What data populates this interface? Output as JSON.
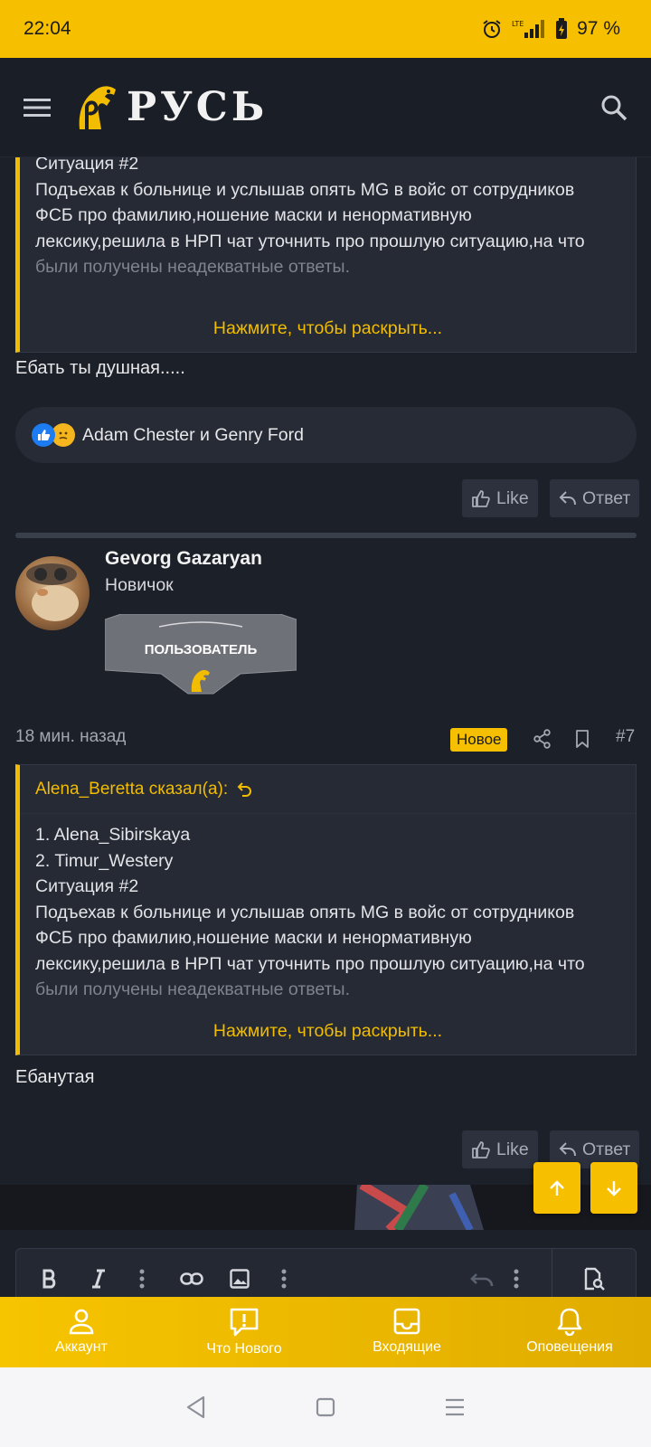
{
  "status_bar": {
    "time": "22:04",
    "battery": "97 %",
    "network": "LTE"
  },
  "app": {
    "logo_text": "РУСЬ"
  },
  "quote1": {
    "lines": [
      "Ситуация #2",
      "Подъехав к больнице и услышав опять MG в войс от сотрудников",
      "ФСБ про фамилию,ношение маски и ненормативную",
      "лексику,решила в НРП чат уточнить про прошлую ситуацию,на что"
    ],
    "fade_line": "были получены неадекватные ответы.",
    "expand_label": "Нажмите, чтобы раскрыть..."
  },
  "post1": {
    "text": "Ебать ты душная.....",
    "reactions_text": "Adam Chester и Genry Ford",
    "like_label": "Like",
    "reply_label": "Ответ"
  },
  "post2": {
    "author": "Gevorg Gazaryan",
    "user_title": "Новичок",
    "banner_text": "ПОЛЬЗОВАТЕЛЬ",
    "time": "18 мин. назад",
    "badge": "Новое",
    "number": "#7",
    "quote_author": "Alena_Beretta сказал(а):",
    "quote_lines": [
      "1. Alena_Sibirskaya",
      "2. Timur_Westery",
      "Ситуация #2",
      "Подъехав к больнице и услышав опять MG в войс от сотрудников",
      "ФСБ про фамилию,ношение маски и ненормативную",
      "лексику,решила в НРП чат уточнить про прошлую ситуацию,на что"
    ],
    "quote_fade_line": "были получены неадекватные ответы.",
    "expand_label": "Нажмите, чтобы раскрыть...",
    "text": "Ебанутая",
    "like_label": "Like",
    "reply_label": "Ответ"
  },
  "bottom_nav": [
    {
      "label": "Аккаунт",
      "icon": "user-icon"
    },
    {
      "label": "Что Нового",
      "icon": "whats-new-icon"
    },
    {
      "label": "Входящие",
      "icon": "inbox-icon"
    },
    {
      "label": "Оповещения",
      "icon": "bell-icon"
    }
  ],
  "colors": {
    "accent": "#f6c000",
    "background": "#1c2029",
    "panel": "#252a35"
  }
}
